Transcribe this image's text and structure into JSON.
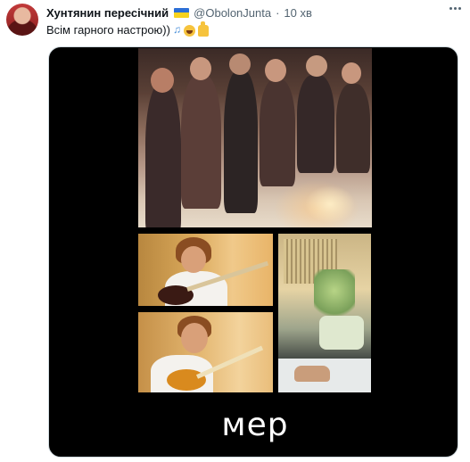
{
  "tweet": {
    "author_name": "Хунтянин пересічний",
    "flag_icon": "ukraine-flag-icon",
    "handle": "@ObolonJunta",
    "separator": "·",
    "time": "10 хв",
    "text": "Всім гарного настрою))",
    "emojis": [
      "musical-notes-icon",
      "grinning-face-icon",
      "thumbs-up-icon"
    ]
  },
  "media": {
    "caption": "мер",
    "panels": [
      "crowd-fire-frame",
      "bass-player-frame",
      "guitar-player-frame",
      "keyboard-frame"
    ]
  },
  "colors": {
    "text_primary": "#0f1419",
    "text_secondary": "#536471",
    "media_background": "#000000",
    "caption_color": "#ffffff"
  }
}
